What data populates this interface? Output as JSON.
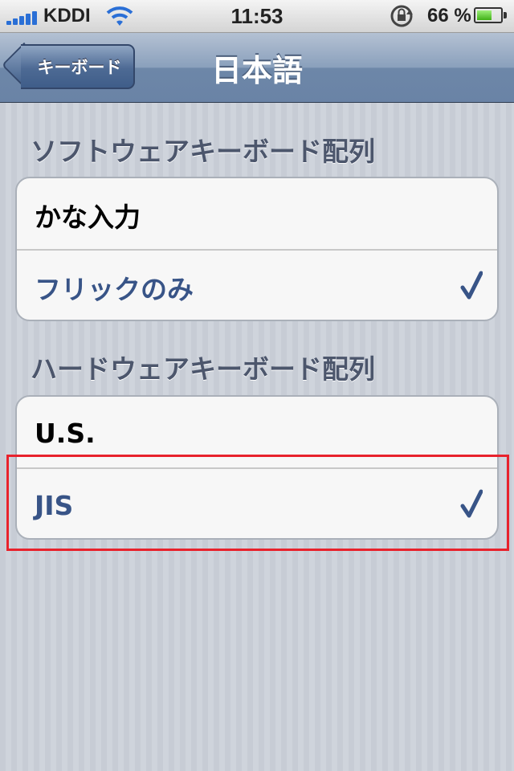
{
  "status_bar": {
    "carrier": "KDDI",
    "time": "11:53",
    "battery_percent": "66 %",
    "battery_level": 0.66,
    "icons": [
      "signal-icon",
      "wifi-icon",
      "rotation-lock-icon",
      "battery-icon"
    ]
  },
  "nav": {
    "back_label": "キーボード",
    "title": "日本語"
  },
  "sections": [
    {
      "header": "ソフトウェアキーボード配列",
      "rows": [
        {
          "label": "かな入力",
          "checked": false
        },
        {
          "label": "フリックのみ",
          "checked": true
        }
      ]
    },
    {
      "header": "ハードウェアキーボード配列",
      "rows": [
        {
          "label": "U.S.",
          "checked": false
        },
        {
          "label": "JIS",
          "checked": true
        }
      ]
    }
  ],
  "colors": {
    "selected_text": "#385487",
    "highlight": "#e8222c"
  }
}
